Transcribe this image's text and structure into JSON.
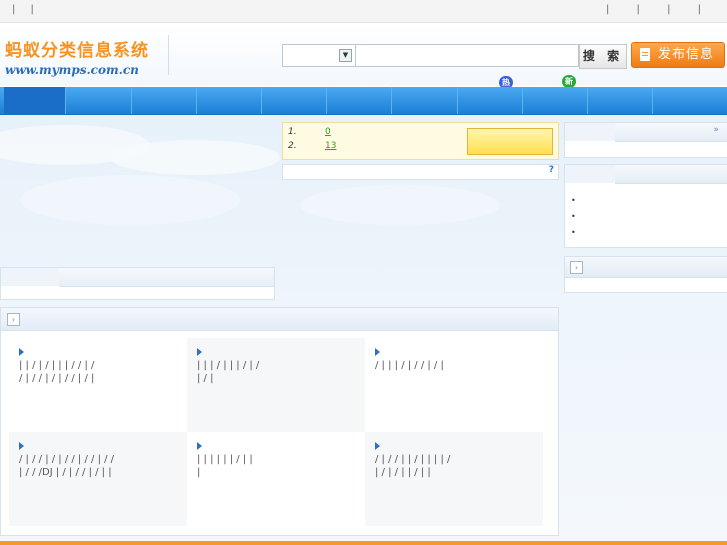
{
  "topbar": {
    "left_text": "| |",
    "right_text": "| | | |"
  },
  "logo": {
    "title_cn": "蚂蚁分类信息系统",
    "url": "www.mymps.com.cn"
  },
  "search": {
    "category_value": "",
    "query_value": "",
    "query_placeholder": "",
    "button_label": "搜 索"
  },
  "post_button": {
    "label": "发布信息"
  },
  "badges": {
    "hot": "热",
    "new": "新"
  },
  "hot_list": {
    "items": [
      {
        "rank": "1.",
        "count": "0"
      },
      {
        "rank": "2.",
        "count": "13"
      }
    ]
  },
  "help": {
    "icon_text": "?"
  },
  "right_panel_top": {
    "more": "»"
  },
  "right_panel_list": {
    "items": [
      "",
      "",
      ""
    ]
  },
  "categories": [
    {
      "lines": [
        "| | / | / | | | / / | /",
        "/ | / / | / | / / | / |"
      ]
    },
    {
      "lines": [
        "| | | / | | | / | /",
        "| / |"
      ]
    },
    {
      "lines": [
        "/ | | | / | / / | / |"
      ]
    },
    {
      "lines": [
        "/ | / / | / | / / | / / | / /",
        "| / / /DJ | / | / / | / | |"
      ]
    },
    {
      "lines": [
        "| | | | | | / | |",
        "|"
      ]
    },
    {
      "lines": [
        "/ | / / | | / | | | | /",
        "| / | / | | / | |"
      ]
    }
  ],
  "colors": {
    "accent_orange": "#f7931e",
    "nav_blue": "#1b7fd7",
    "link_green": "#3a9a1a"
  }
}
